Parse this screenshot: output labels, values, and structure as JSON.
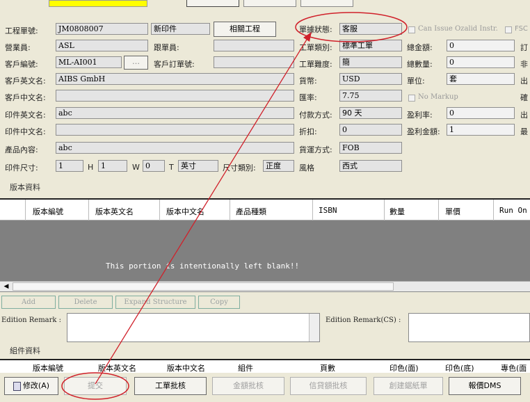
{
  "form": {
    "job_no": {
      "label": "工程單號:",
      "value": "JM0808007"
    },
    "job_type_value": "新印件",
    "related_button": "相關工程",
    "order_status": {
      "label": "單據狀態:",
      "value": "客服"
    },
    "can_issue": "Can Issue Ozalid Instr.",
    "fsc": "FSC",
    "salesperson": {
      "label": "營業員:",
      "value": "ASL"
    },
    "follower": {
      "label": "跟單員:",
      "value": ""
    },
    "job_category": {
      "label": "工單類別:",
      "value": "標準工單"
    },
    "total_amount": {
      "label": "總金額:",
      "value": "0"
    },
    "customer_no": {
      "label": "客戶編號:",
      "value": "ML-AI001"
    },
    "customer_order": {
      "label": "客戶訂單號:",
      "value": ""
    },
    "difficulty": {
      "label": "工單難度:",
      "value": "簡"
    },
    "total_qty": {
      "label": "總數量:",
      "value": "0"
    },
    "customer_en": {
      "label": "客戶英文名:",
      "value": "AIBS GmbH"
    },
    "currency": {
      "label": "貨幣:",
      "value": "USD"
    },
    "unit": {
      "label": "單位:",
      "value": "套"
    },
    "customer_cn": {
      "label": "客戶中文名:",
      "value": ""
    },
    "exchange_rate": {
      "label": "匯率:",
      "value": "7.75"
    },
    "no_markup": "No Markup",
    "print_en": {
      "label": "印件英文名:",
      "value": "abc"
    },
    "payment": {
      "label": "付款方式:",
      "value": "90 天"
    },
    "profit_rate": {
      "label": "盈利率:",
      "value": "0"
    },
    "print_cn": {
      "label": "印件中文名:",
      "value": ""
    },
    "discount": {
      "label": "折扣:",
      "value": "0"
    },
    "profit_amount": {
      "label": "盈利金額:",
      "value": "1"
    },
    "product": {
      "label": "產品內容:",
      "value": "abc"
    },
    "shipping": {
      "label": "貨運方式:",
      "value": "FOB"
    },
    "size": {
      "label": "印件尺寸:",
      "l": "1",
      "h_label": "H",
      "h": "1",
      "w_label": "W",
      "w": "0",
      "t_label": "T",
      "unit": "英寸"
    },
    "size_type": {
      "label": "尺寸類別:",
      "value": "正度"
    },
    "style": {
      "label": "風格",
      "value": "西式"
    },
    "right_clip": [
      "訂",
      "非",
      "出",
      "確",
      "出",
      "最"
    ]
  },
  "version_section": {
    "title": "版本資料",
    "columns": [
      "版本編號",
      "版本英文名",
      "版本中文名",
      "產品種類",
      "ISBN",
      "數量",
      "單價",
      "Run On"
    ],
    "blank_text": "This portion is intentionally left blank!!",
    "buttons": [
      "Add",
      "Delete",
      "Expand Structure",
      "Copy"
    ]
  },
  "remarks": {
    "edition": "Edition Remark :",
    "edition_cs": "Edition Remark(CS) :"
  },
  "component_section": {
    "title": "組件資料",
    "columns": [
      "版本編號",
      "版本英文名",
      "版本中文名",
      "組件",
      "頁數",
      "印色(面)",
      "印色(底)",
      "專色(面"
    ]
  },
  "bottom_buttons": {
    "modify": "修改(A)",
    "submit": "提交",
    "job_approve": "工單批核",
    "amount_approve": "金額批核",
    "credit_approve": "信貸額批核",
    "create_quote": "創建鋸紙單",
    "quote_dms": "報價DMS"
  },
  "colors": {
    "annotation": "#d0202a",
    "highlight": "#ffff00",
    "grid_body": "#808080"
  }
}
